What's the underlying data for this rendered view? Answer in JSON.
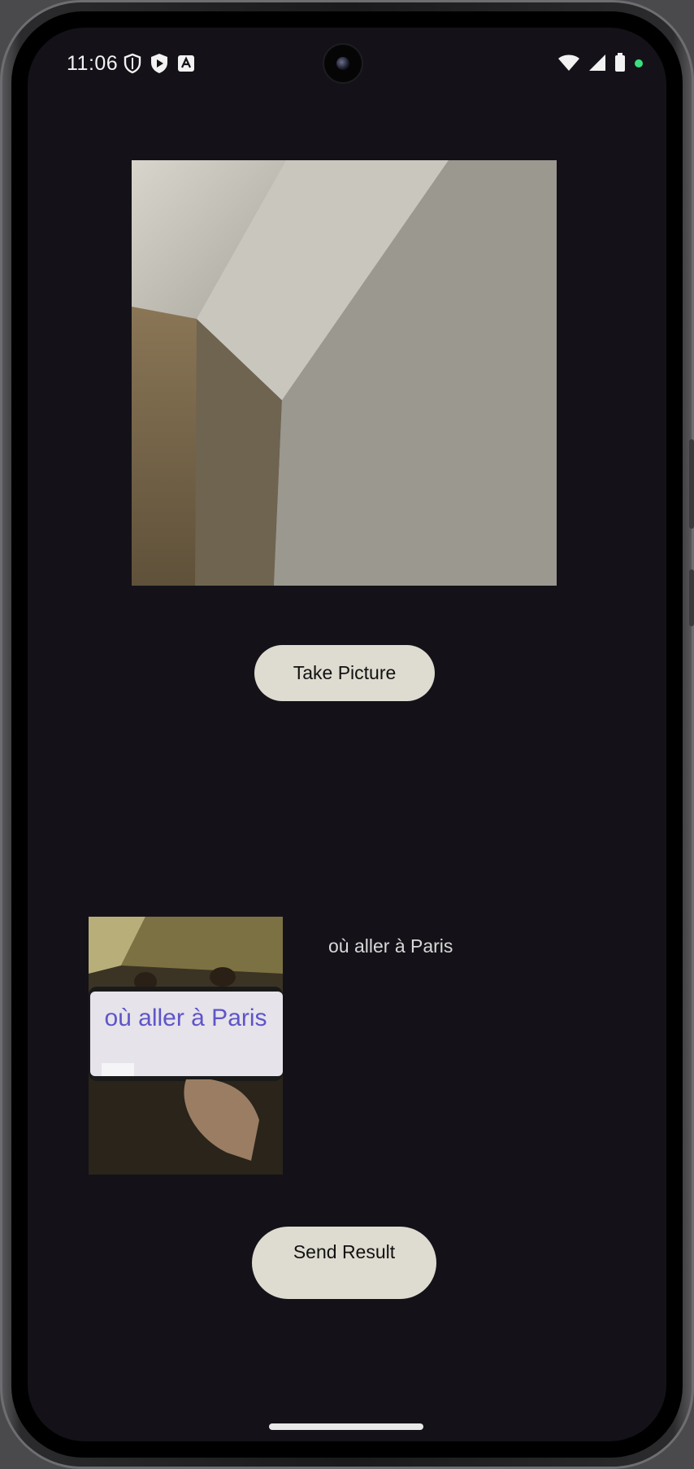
{
  "status_bar": {
    "time": "11:06",
    "left_icons": [
      "shield-icon",
      "play-protect-icon",
      "a-badge-icon"
    ],
    "right_icons": [
      "wifi-icon",
      "cellular-signal-icon",
      "battery-icon",
      "green-dot-icon"
    ]
  },
  "camera": {
    "take_picture_label": "Take Picture"
  },
  "result": {
    "captured_text": "où aller à Paris",
    "thumbnail_text": "où aller à Paris",
    "send_label": "Send Result"
  },
  "colors": {
    "screen_bg": "#141218",
    "button_bg": "#dedbd0",
    "thumbnail_text": "#5e55c8"
  }
}
